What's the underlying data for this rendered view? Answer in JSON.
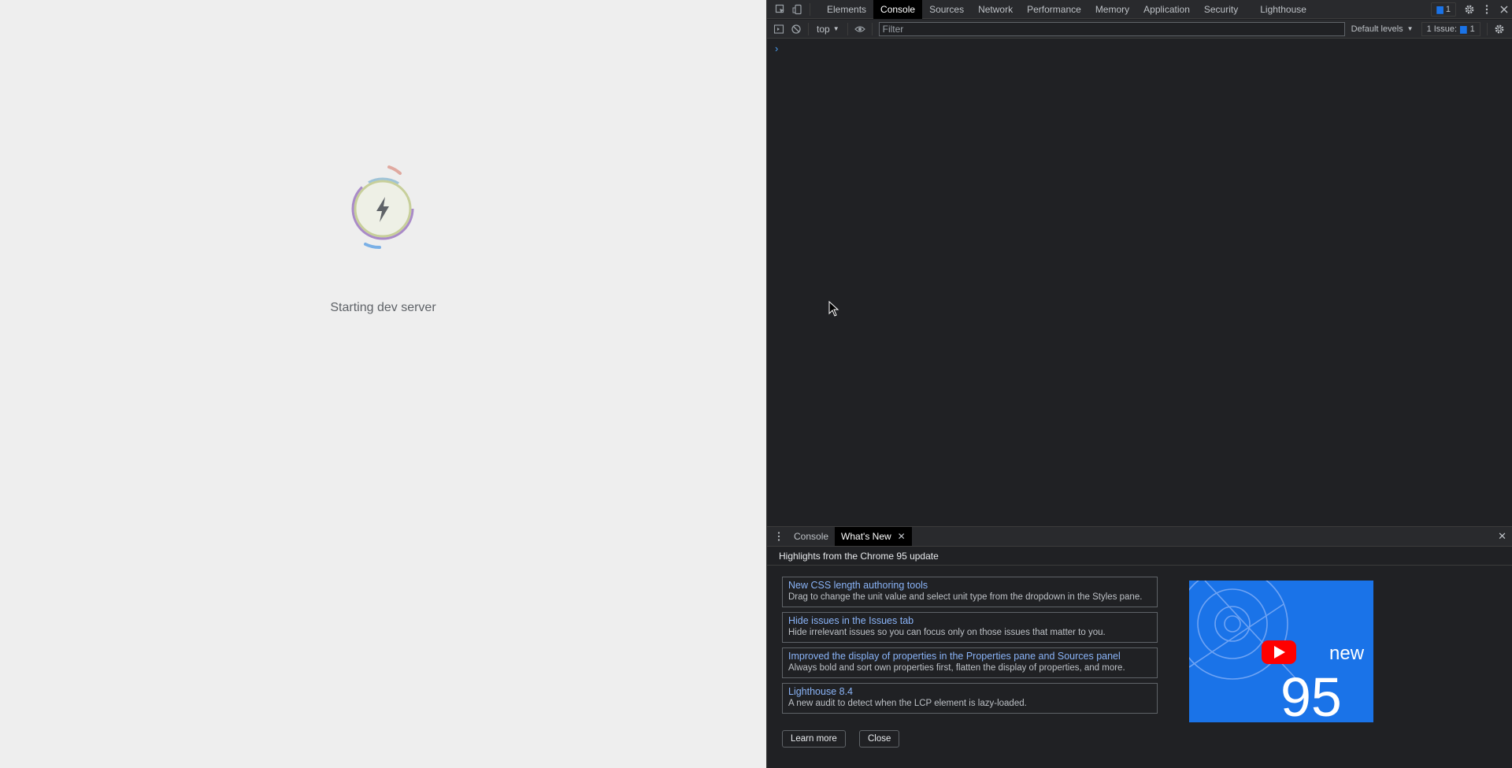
{
  "page": {
    "status_text": "Starting dev server",
    "spinner_icon": "lightning-bolt-icon"
  },
  "devtools": {
    "main_tabs": [
      "Elements",
      "Console",
      "Sources",
      "Network",
      "Performance",
      "Memory",
      "Application",
      "Security",
      "Lighthouse"
    ],
    "active_tab": "Console",
    "messages_badge": "1",
    "console_toolbar": {
      "context": "top",
      "filter_placeholder": "Filter",
      "levels": "Default levels",
      "issues_label": "1 Issue:",
      "issues_count": "1"
    },
    "prompt_symbol": "›",
    "drawer": {
      "tabs": [
        "Console",
        "What's New"
      ],
      "active_tab": "What's New",
      "header": "Highlights from the Chrome 95 update",
      "features": [
        {
          "title": "New CSS length authoring tools",
          "desc": "Drag to change the unit value and select unit type from the dropdown in the Styles pane."
        },
        {
          "title": "Hide issues in the Issues tab",
          "desc": "Hide irrelevant issues so you can focus only on those issues that matter to you."
        },
        {
          "title": "Improved the display of properties in the Properties pane and Sources panel",
          "desc": "Always bold and sort own properties first, flatten the display of properties, and more."
        },
        {
          "title": "Lighthouse 8.4",
          "desc": "A new audit to detect when the LCP element is lazy-loaded."
        }
      ],
      "video": {
        "word": "new",
        "number": "95"
      },
      "learn_more": "Learn more",
      "close": "Close"
    }
  },
  "colors": {
    "accent": "#1a73e8",
    "link": "#8ab4f8",
    "panel_bg": "#202124",
    "page_bg": "#eeeeee"
  }
}
